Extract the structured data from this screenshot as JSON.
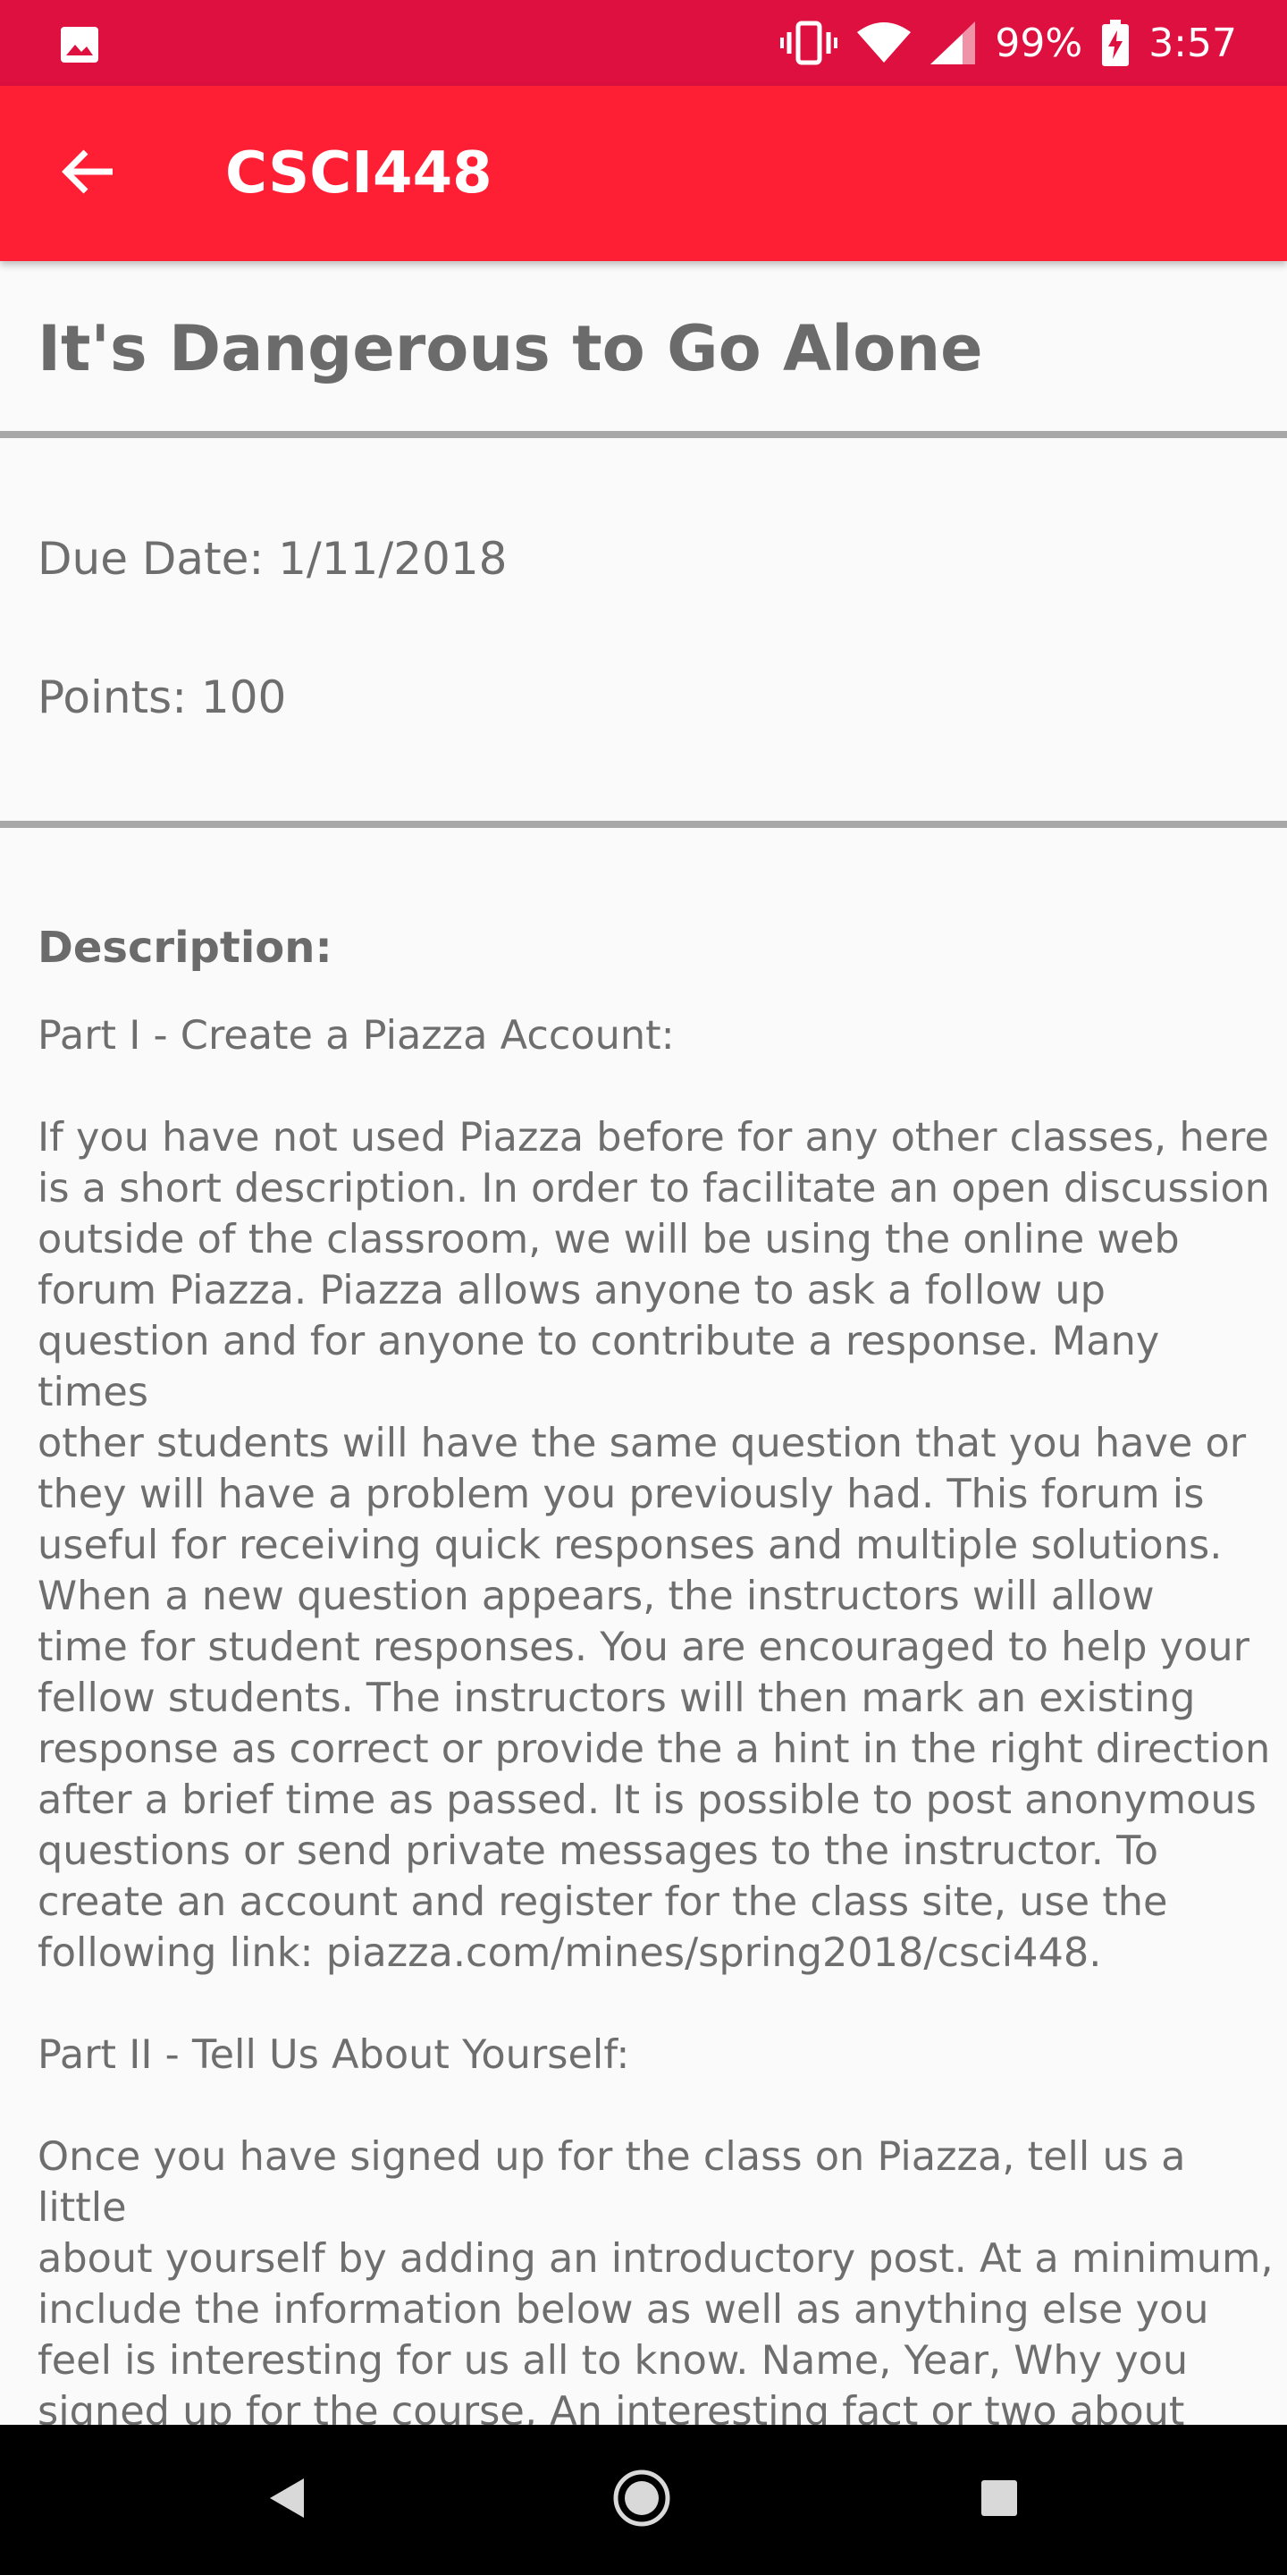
{
  "status_bar": {
    "battery": "99%",
    "time": "3:57",
    "icons": [
      "image-icon",
      "vibrate-icon",
      "wifi-icon",
      "signal-icon",
      "battery-charging-icon"
    ]
  },
  "app_bar": {
    "back_icon": "arrow-back-icon",
    "title": "CSCI448"
  },
  "assignment": {
    "title": "It's Dangerous to Go Alone",
    "due_date": "Due Date: 1/11/2018",
    "points": "Points: 100",
    "description_heading": "Description:",
    "description_paragraphs": [
      "Part I - Create a Piazza Account:",
      "If you have not used Piazza before for any other classes, here\nis a short description. In order to facilitate an open discussion\noutside of the classroom, we will be using the online web\nforum Piazza. Piazza allows anyone to ask a follow up\nquestion and for anyone to contribute a response. Many times\nother students will have the same question that you have or\nthey will have a problem you previously had. This forum is\nuseful for receiving quick responses and multiple solutions.\nWhen a new question appears, the instructors will allow\ntime for student responses. You are encouraged to help your\nfellow students. The instructors will then mark an existing\nresponse as correct or provide the a hint in the right direction\nafter a brief time as passed.  It is possible to post anonymous\nquestions or send private messages to the instructor.  To\ncreate an account and register for the class site, use the\nfollowing link: piazza.com/mines/spring2018/csci448.",
      "Part II - Tell Us About Yourself:",
      "Once you have signed up for the class on Piazza, tell us a little\nabout yourself by adding an introductory post. At a minimum,\ninclude the information below as well as anything else you\nfeel is interesting for us all to know. Name, Year, Why you\nsigned up for the course, An interesting fact or two about\nyourself"
    ]
  },
  "nav_bar": {
    "icons": [
      "back-triangle-icon",
      "home-circle-icon",
      "recents-square-icon"
    ]
  },
  "colors": {
    "status_bar": "#dd1040",
    "app_bar": "#ff1f35",
    "text": "#6e6e6e",
    "divider": "#a8a8a8",
    "background": "#fafafa"
  }
}
